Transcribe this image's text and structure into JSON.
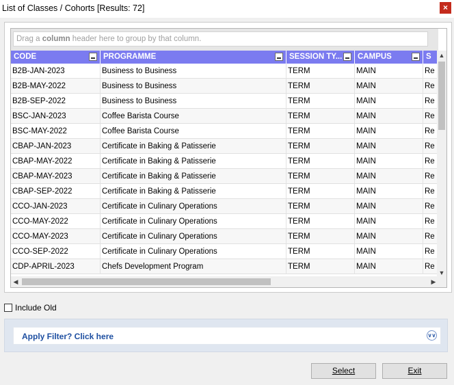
{
  "window": {
    "title": "List of Classes / Cohorts [Results: 72]",
    "close_glyph": "×"
  },
  "group_panel": {
    "prefix": "Drag a ",
    "bold": "column",
    "suffix": " header here to group by that column."
  },
  "columns": [
    {
      "key": "code",
      "label": "CODE"
    },
    {
      "key": "programme",
      "label": "PROGRAMME"
    },
    {
      "key": "session",
      "label": "SESSION TY..."
    },
    {
      "key": "campus",
      "label": "CAMPUS"
    },
    {
      "key": "s",
      "label": "S"
    }
  ],
  "rows": [
    {
      "code": "B2B-JAN-2023",
      "programme": "Business to Business",
      "session": "TERM",
      "campus": "MAIN",
      "s": "Re"
    },
    {
      "code": "B2B-MAY-2022",
      "programme": "Business to Business",
      "session": "TERM",
      "campus": "MAIN",
      "s": "Re"
    },
    {
      "code": "B2B-SEP-2022",
      "programme": "Business to Business",
      "session": "TERM",
      "campus": "MAIN",
      "s": "Re"
    },
    {
      "code": "BSC-JAN-2023",
      "programme": "Coffee Barista Course",
      "session": "TERM",
      "campus": "MAIN",
      "s": "Re"
    },
    {
      "code": "BSC-MAY-2022",
      "programme": "Coffee Barista Course",
      "session": "TERM",
      "campus": "MAIN",
      "s": "Re"
    },
    {
      "code": "CBAP-JAN-2023",
      "programme": "Certificate in Baking & Patisserie",
      "session": "TERM",
      "campus": "MAIN",
      "s": "Re"
    },
    {
      "code": "CBAP-MAY-2022",
      "programme": "Certificate in Baking & Patisserie",
      "session": "TERM",
      "campus": "MAIN",
      "s": "Re"
    },
    {
      "code": "CBAP-MAY-2023",
      "programme": "Certificate in Baking & Patisserie",
      "session": "TERM",
      "campus": "MAIN",
      "s": "Re"
    },
    {
      "code": "CBAP-SEP-2022",
      "programme": "Certificate in Baking & Patisserie",
      "session": "TERM",
      "campus": "MAIN",
      "s": "Re"
    },
    {
      "code": "CCO-JAN-2023",
      "programme": "Certificate in Culinary Operations",
      "session": "TERM",
      "campus": "MAIN",
      "s": "Re"
    },
    {
      "code": "CCO-MAY-2022",
      "programme": "Certificate in Culinary Operations",
      "session": "TERM",
      "campus": "MAIN",
      "s": "Re"
    },
    {
      "code": "CCO-MAY-2023",
      "programme": "Certificate in Culinary Operations",
      "session": "TERM",
      "campus": "MAIN",
      "s": "Re"
    },
    {
      "code": "CCO-SEP-2022",
      "programme": "Certificate in Culinary Operations",
      "session": "TERM",
      "campus": "MAIN",
      "s": "Re"
    },
    {
      "code": "CDP-APRIL-2023",
      "programme": "Chefs Development Program",
      "session": "TERM",
      "campus": "MAIN",
      "s": "Re"
    }
  ],
  "include_old": {
    "label": "Include Old",
    "checked": false
  },
  "filter": {
    "label": "Apply Filter? Click here",
    "icon": "double-chevron-down-icon"
  },
  "buttons": {
    "select": "Select",
    "exit": "Exit"
  },
  "colors": {
    "header_bg": "#7b7bf0",
    "link": "#1e4fa1",
    "close_bg": "#c42b1c"
  }
}
